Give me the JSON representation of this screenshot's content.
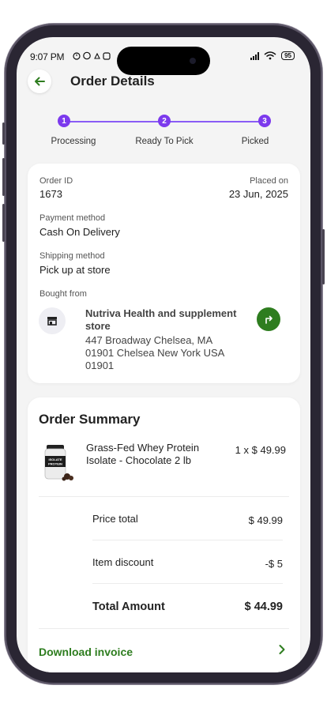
{
  "status_bar": {
    "time": "9:07 PM",
    "battery": "95"
  },
  "header": {
    "title": "Order Details"
  },
  "stepper": {
    "steps": [
      {
        "number": "1",
        "label": "Processing"
      },
      {
        "number": "2",
        "label": "Ready To Pick"
      },
      {
        "number": "3",
        "label": "Picked"
      }
    ],
    "accent_color": "#7c3aed"
  },
  "order_info": {
    "order_id_label": "Order ID",
    "order_id": "1673",
    "placed_on_label": "Placed on",
    "placed_on": "23 Jun, 2025",
    "payment_label": "Payment method",
    "payment": "Cash On Delivery",
    "shipping_label": "Shipping method",
    "shipping": "Pick up at store",
    "bought_from_label": "Bought from",
    "store_name": "Nutriva Health and supplement store",
    "store_address": "447 Broadway  Chelsea, MA 01901 Chelsea New York USA 01901"
  },
  "summary": {
    "title": "Order Summary",
    "item": {
      "name": "Grass-Fed Whey Protein Isolate - Chocolate 2 lb",
      "quantity_price": "1 x $ 49.99",
      "image_label": "ISOLATE PROTEIN"
    },
    "price_total_label": "Price total",
    "price_total": "$ 49.99",
    "discount_label": "Item discount",
    "discount": "-$ 5",
    "total_label": "Total Amount",
    "total": "$ 44.99",
    "download_label": "Download invoice"
  },
  "colors": {
    "brand_green": "#2e7d1f",
    "step_purple": "#7c3aed",
    "background": "#f4f4f4"
  }
}
